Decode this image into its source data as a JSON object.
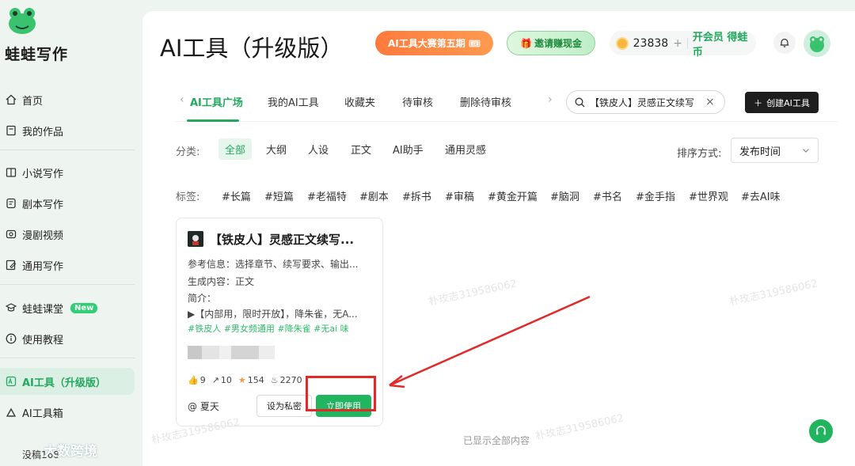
{
  "sidebar": {
    "brand": "蛙蛙写作",
    "items": [
      {
        "label": "首页",
        "icon": "home-icon"
      },
      {
        "label": "我的作品",
        "icon": "book-icon"
      },
      {
        "label": "小说写作",
        "icon": "novel-icon"
      },
      {
        "label": "剧本写作",
        "icon": "script-icon"
      },
      {
        "label": "漫剧视频",
        "icon": "video-icon"
      },
      {
        "label": "通用写作",
        "icon": "edit-icon"
      },
      {
        "label": "蛙蛙课堂",
        "icon": "graduation-cap-icon",
        "badge": "New"
      },
      {
        "label": "使用教程",
        "icon": "info-icon"
      },
      {
        "label": "AI工具（升级版）",
        "icon": "ai-tool-icon",
        "active": true
      },
      {
        "label": "AI工具箱",
        "icon": "toolbox-icon"
      }
    ],
    "bottom_text": "没稿168"
  },
  "header": {
    "title": "AI工具（升级版）",
    "promo_contest": "AI工具大赛第五期",
    "promo_invite": "邀请赚现金",
    "coins": "23838",
    "coins_plus": "+",
    "member_text": "开会员 得蛙币"
  },
  "tabs": {
    "items": [
      "AI工具广场",
      "我的AI工具",
      "收藏夹",
      "待审核",
      "删除待审核"
    ],
    "left_arrow": "‹",
    "right_arrow": "›"
  },
  "search": {
    "value": "【铁皮人】灵感正文续写",
    "clear": "×"
  },
  "create_button": "创建AI工具",
  "filters": {
    "category_label": "分类:",
    "categories": [
      "全部",
      "大纲",
      "人设",
      "正文",
      "AI助手",
      "通用灵感"
    ],
    "sort_label": "排序方式:",
    "sort_value": "发布时间",
    "tag_label": "标签:",
    "tags": [
      "#长篇",
      "#短篇",
      "#老福特",
      "#剧本",
      "#拆书",
      "#审稿",
      "#黄金开篇",
      "#脑洞",
      "#书名",
      "#金手指",
      "#世界观",
      "#去AI味"
    ]
  },
  "card": {
    "title": "【铁皮人】灵感正文续写...",
    "reference": "参考信息：选择章节、续写要求、输出...",
    "generated": "生成内容：正文",
    "intro_label": "简介：",
    "intro_text": "▶【内部用，限时开放】，降朱雀，无A...",
    "tags": "#铁皮人  #男女频通用  #降朱雀  #无ai 味",
    "likes": "9",
    "shares": "10",
    "stars": "154",
    "uses": "2270",
    "author": "@ 夏天",
    "private_button": "设为私密",
    "use_button": "立即使用"
  },
  "footer_text": "已显示全部内容",
  "watermark_text": "朴玫志319586062",
  "bottom_watermark": "大数跨境",
  "colors": {
    "accent": "#23a85f",
    "annotation": "#e02a2a"
  }
}
